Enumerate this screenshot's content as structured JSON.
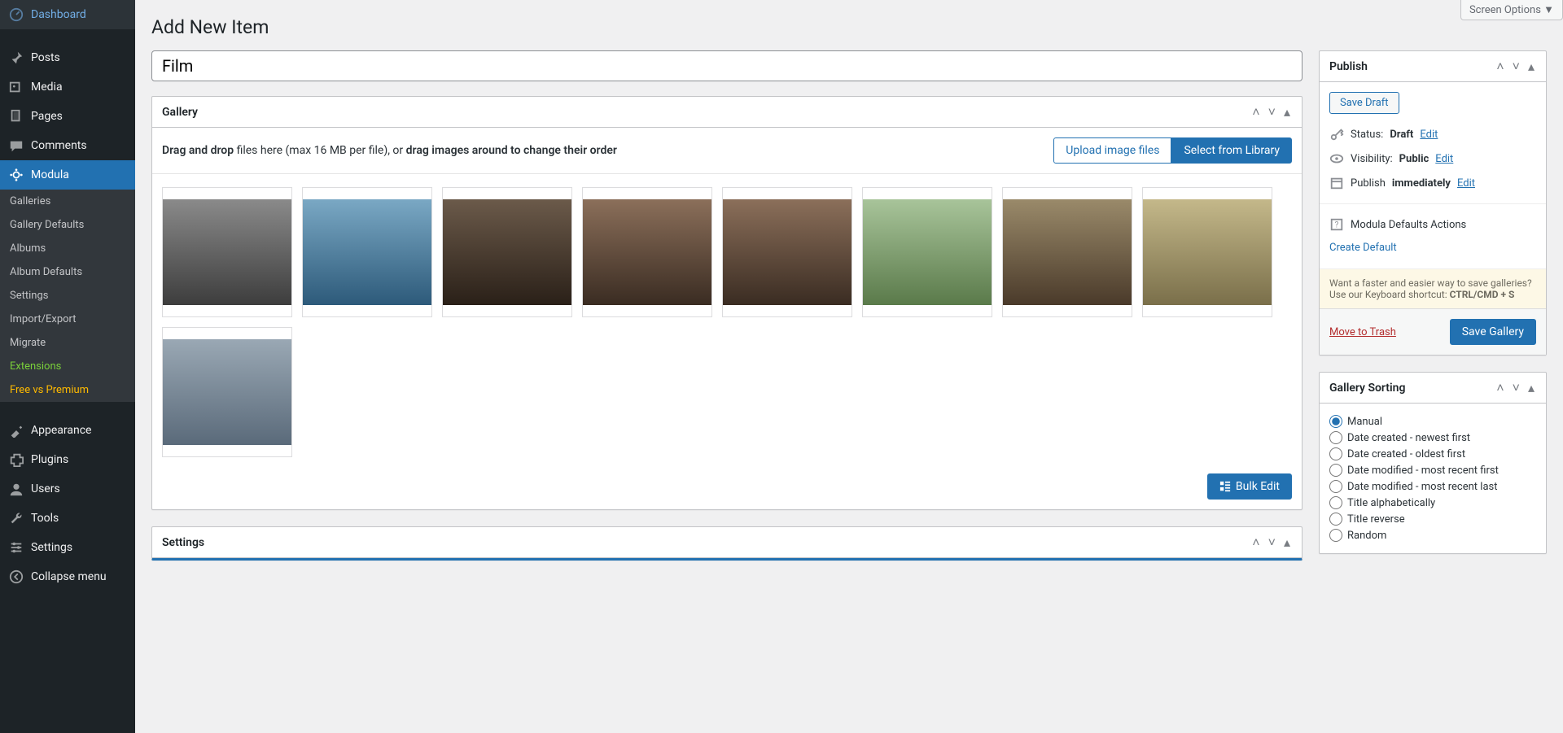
{
  "screenOptions": "Screen Options ▼",
  "pageTitle": "Add New Item",
  "titleValue": "Film",
  "sidebar": {
    "items": [
      {
        "label": "Dashboard"
      },
      {
        "label": "Posts"
      },
      {
        "label": "Media"
      },
      {
        "label": "Pages"
      },
      {
        "label": "Comments"
      },
      {
        "label": "Modula"
      },
      {
        "label": "Appearance"
      },
      {
        "label": "Plugins"
      },
      {
        "label": "Users"
      },
      {
        "label": "Tools"
      },
      {
        "label": "Settings"
      },
      {
        "label": "Collapse menu"
      }
    ],
    "submenu": [
      {
        "label": "Galleries"
      },
      {
        "label": "Gallery Defaults"
      },
      {
        "label": "Albums"
      },
      {
        "label": "Album Defaults"
      },
      {
        "label": "Settings"
      },
      {
        "label": "Import/Export"
      },
      {
        "label": "Migrate"
      },
      {
        "label": "Extensions",
        "cls": "ext"
      },
      {
        "label": "Free vs Premium",
        "cls": "free"
      }
    ]
  },
  "gallery": {
    "title": "Gallery",
    "hintBold1": "Drag and drop",
    "hintText": " files here (max 16 MB per file), or ",
    "hintBold2": "drag images around to change their order",
    "uploadBtn": "Upload image files",
    "libraryBtn": "Select from Library",
    "bulkEdit": "Bulk Edit",
    "thumbs": [
      {
        "bg": "linear-gradient(180deg,#8a8a8a,#3d3d3d)"
      },
      {
        "bg": "linear-gradient(180deg,#7aa8c4,#2d5a7a)"
      },
      {
        "bg": "linear-gradient(180deg,#6b5a4a,#2a2018)"
      },
      {
        "bg": "linear-gradient(180deg,#8b6f5a,#3a2c22)"
      },
      {
        "bg": "linear-gradient(180deg,#8b6f5a,#3a2c22)"
      },
      {
        "bg": "linear-gradient(180deg,#a8c49a,#5a7a4a)"
      },
      {
        "bg": "linear-gradient(180deg,#9a8a6a,#4a3a2a)"
      },
      {
        "bg": "linear-gradient(180deg,#c4b88a,#7a6f4a)"
      },
      {
        "bg": "linear-gradient(180deg,#9aa8b4,#5a6a7a)"
      }
    ]
  },
  "settings": {
    "title": "Settings"
  },
  "publish": {
    "title": "Publish",
    "saveDraft": "Save Draft",
    "statusLabel": "Status:",
    "statusValue": "Draft",
    "edit": "Edit",
    "visibilityLabel": "Visibility:",
    "visibilityValue": "Public",
    "publishLabel": "Publish",
    "publishValue": "immediately",
    "defaultsActions": "Modula Defaults Actions",
    "createDefault": "Create Default",
    "shortcutNote1": "Want a faster and easier way to save galleries? Use our Keyboard shortcut: ",
    "shortcutNote2": "CTRL/CMD + S",
    "moveToTrash": "Move to Trash",
    "saveGallery": "Save Gallery"
  },
  "sorting": {
    "title": "Gallery Sorting",
    "options": [
      "Manual",
      "Date created - newest first",
      "Date created - oldest first",
      "Date modified - most recent first",
      "Date modified - most recent last",
      "Title alphabetically",
      "Title reverse",
      "Random"
    ],
    "selected": 0
  }
}
